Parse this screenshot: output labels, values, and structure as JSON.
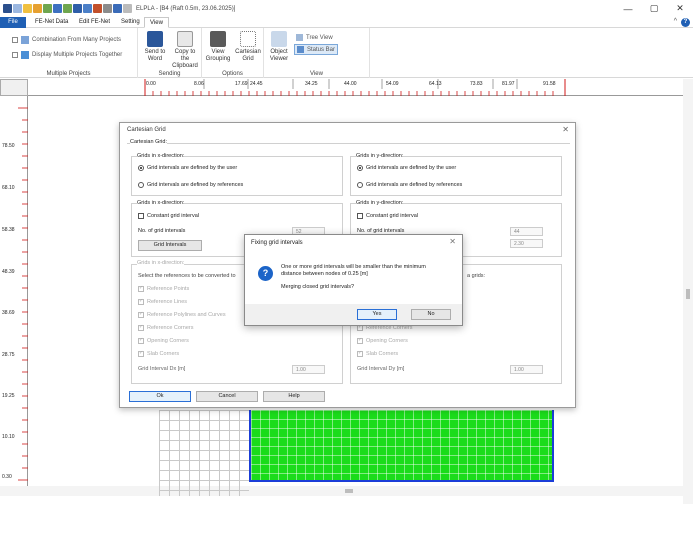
{
  "app": {
    "title": "ELPLA - [B4 (Raft 0.5m, 23.06.2025)]"
  },
  "window_controls": [
    "—",
    "▢",
    "✕"
  ],
  "tabs": [
    {
      "label": "File"
    },
    {
      "label": "FE-Net Data"
    },
    {
      "label": "Edit FE-Net"
    },
    {
      "label": "Setting"
    },
    {
      "label": "View"
    }
  ],
  "ribbon": {
    "multiple_projects": {
      "label": "Multiple Projects",
      "combination": "Combination From Many Projects",
      "display": "Display Multiple Projects Together"
    },
    "sending": {
      "label": "Sending",
      "send_word": "Send to Word",
      "copy_clipboard": "Copy to the Clipboard"
    },
    "options": {
      "label": "Options",
      "view_grouping": "View Grouping",
      "cartesian_grid": "Cartesian Grid"
    },
    "view": {
      "label": "View",
      "object_viewer": "Object Viewer",
      "tree_view": "Tree View",
      "status_bar": "Status Bar"
    }
  },
  "ruler": {
    "h_labels": [
      "0.00",
      "8.06",
      "17.69",
      "24.45",
      "34.25",
      "44.00",
      "54.09",
      "64.13",
      "73.83",
      "81.97",
      "91.58"
    ],
    "v_labels": [
      "78.50",
      "68.10",
      "58.38",
      "48.39",
      "38.69",
      "28.75",
      "19.25",
      "10.10",
      "0.30"
    ]
  },
  "dialog": {
    "title": "Cartesian Grid",
    "section": "Cartesian Grid:",
    "x_dir": {
      "title": "Grids in x-direction:",
      "opt_user": "Grid intervals are defined by the user",
      "opt_ref": "Grid intervals are defined by references",
      "title2": "Grids in x-direction:",
      "constant": "Constant grid interval",
      "no_label": "No. of grid intervals",
      "no_value": "52",
      "grid_btn": "Grid Intervals",
      "title3": "Grids in x-direction:",
      "select_text": "Select the references to be converted to",
      "refs": [
        "Reference Points",
        "Reference Lines",
        "Reference Polylines and Curves",
        "Reference Corners",
        "Opening Corners",
        "Slab Corners"
      ],
      "interval_label": "Grid Interval Dx [m]",
      "interval_value": "1.00"
    },
    "y_dir": {
      "title": "Grids in y-direction:",
      "opt_user": "Grid intervals are defined by the user",
      "opt_ref": "Grid intervals are defined by references",
      "title2": "Grids in y-direction:",
      "constant": "Constant grid interval",
      "no_label": "No. of grid intervals",
      "no_value": "44",
      "spacing_value": "2.30",
      "grids_text": "a grids:",
      "refs": [
        "Reference Corners",
        "Opening Corners",
        "Slab Corners"
      ],
      "interval_label": "Grid Interval Dy [m]",
      "interval_value": "1.00"
    },
    "ok": "Ok",
    "cancel": "Cancel",
    "help": "Help"
  },
  "msgbox": {
    "title": "Fixing grid intervals",
    "line1": "One or more grid intervals will be smaller than the minimum",
    "line2": "distance between nodes of 0.25 [m]",
    "line3": "Merging closed grid intervals?",
    "yes": "Yes",
    "no": "No",
    "icon": "question-icon"
  },
  "colors": {
    "file_tab": "#1f5fb4",
    "mesh_green": "#1adc1a",
    "slab_border": "#1b3dd8",
    "ruler_red": "#d01818"
  }
}
